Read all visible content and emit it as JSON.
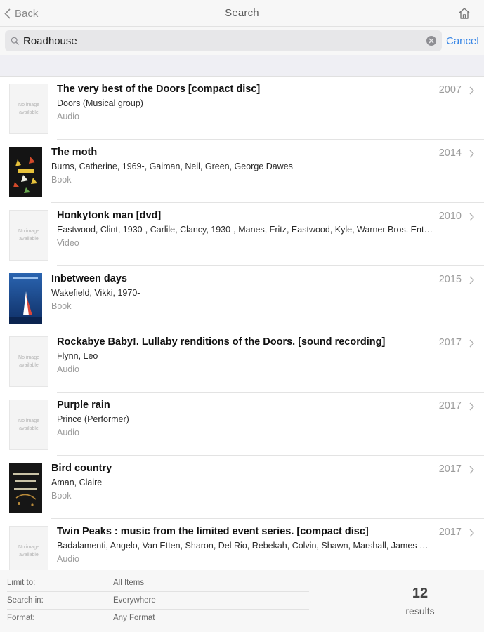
{
  "nav": {
    "back_label": "Back",
    "title": "Search"
  },
  "search": {
    "query": "Roadhouse",
    "cancel_label": "Cancel"
  },
  "results": [
    {
      "title": "The very best of the Doors [compact disc]",
      "author": "Doors (Musical group)",
      "format": "Audio",
      "year": "2007",
      "cover": "none",
      "no_image_text": "No image available"
    },
    {
      "title": "The moth",
      "author": "Burns, Catherine, 1969-, Gaiman, Neil, Green, George Dawes",
      "format": "Book",
      "year": "2014",
      "cover": "moth"
    },
    {
      "title": "Honkytonk man [dvd]",
      "author": "Eastwood, Clint, 1930-, Carlile, Clancy, 1930-, Manes, Fritz, Eastwood, Kyle, Warner Bros. Ente...",
      "format": "Video",
      "year": "2010",
      "cover": "none",
      "no_image_text": "No image available"
    },
    {
      "title": "Inbetween days",
      "author": "Wakefield, Vikki, 1970-",
      "format": "Book",
      "year": "2015",
      "cover": "inbetween"
    },
    {
      "title": "Rockabye Baby!. Lullaby renditions of the Doors. [sound recording]",
      "author": "Flynn, Leo",
      "format": "Audio",
      "year": "2017",
      "cover": "none",
      "no_image_text": "No image available"
    },
    {
      "title": "Purple rain",
      "author": "Prince (Performer)",
      "format": "Audio",
      "year": "2017",
      "cover": "none",
      "no_image_text": "No image available"
    },
    {
      "title": "Bird country",
      "author": "Aman, Claire",
      "format": "Book",
      "year": "2017",
      "cover": "birdcountry"
    },
    {
      "title": "Twin Peaks : music from the limited event series. [compact disc]",
      "author": "Badalamenti, Angelo, Van Etten, Sharon, Del Rio, Rebekah, Colvin, Shawn, Marshall, James W., ...",
      "format": "Audio",
      "year": "2017",
      "cover": "none",
      "no_image_text": "No image available"
    }
  ],
  "filters": [
    {
      "label": "Limit to:",
      "value": "All Items"
    },
    {
      "label": "Search in:",
      "value": "Everywhere"
    },
    {
      "label": "Format:",
      "value": "Any Format"
    }
  ],
  "result_count": {
    "number": "12",
    "label": "results"
  },
  "icons": {
    "back": "chevron-left-icon",
    "home": "home-icon",
    "search": "magnifier-icon",
    "clear": "clear-circle-icon",
    "row": "chevron-right-icon"
  },
  "colors": {
    "accent": "#3a87e6",
    "nav_bg": "#f7f7f7",
    "separator": "#e3e3e3"
  }
}
